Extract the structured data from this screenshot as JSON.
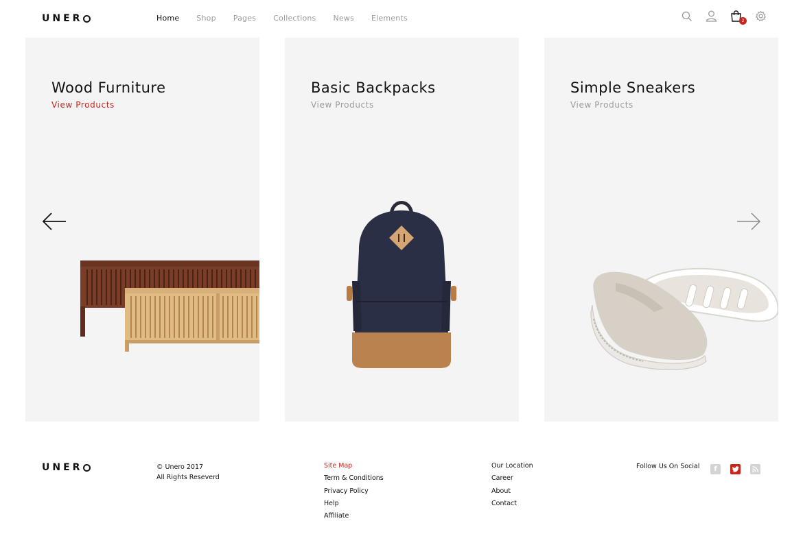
{
  "brand": {
    "logo_text": "UNER",
    "accent": "#c6261c"
  },
  "nav": {
    "items": [
      {
        "label": "Home",
        "active": true
      },
      {
        "label": "Shop",
        "active": false
      },
      {
        "label": "Pages",
        "active": false
      },
      {
        "label": "Collections",
        "active": false
      },
      {
        "label": "News",
        "active": false
      },
      {
        "label": "Elements",
        "active": false
      }
    ]
  },
  "header_icons": [
    "search-icon",
    "user-icon",
    "cart-icon",
    "settings-icon"
  ],
  "cart": {
    "count": "2"
  },
  "panels": [
    {
      "title": "Wood Furniture",
      "link": "View Products",
      "link_active": true
    },
    {
      "title": "Basic Backpacks",
      "link": "View Products",
      "link_active": false
    },
    {
      "title": "Simple Sneakers",
      "link": "View Products",
      "link_active": false
    }
  ],
  "footer": {
    "copyright": "© Unero 2017",
    "rights": "All Rights Reseverd",
    "col1": [
      "Site Map",
      "Term & Conditions",
      "Privacy Policy",
      "Help",
      "Affiliate"
    ],
    "col2": [
      "Our Location",
      "Career",
      "About",
      "Contact"
    ],
    "follow_label": "Follow Us On Social",
    "socials": [
      {
        "icon": "facebook-icon",
        "glyph": "f",
        "color": "#cfcfcf"
      },
      {
        "icon": "twitter-icon",
        "glyph": "t",
        "color": "#c6261c"
      },
      {
        "icon": "rss-icon",
        "glyph": "r",
        "color": "#cfcfcf"
      }
    ]
  }
}
